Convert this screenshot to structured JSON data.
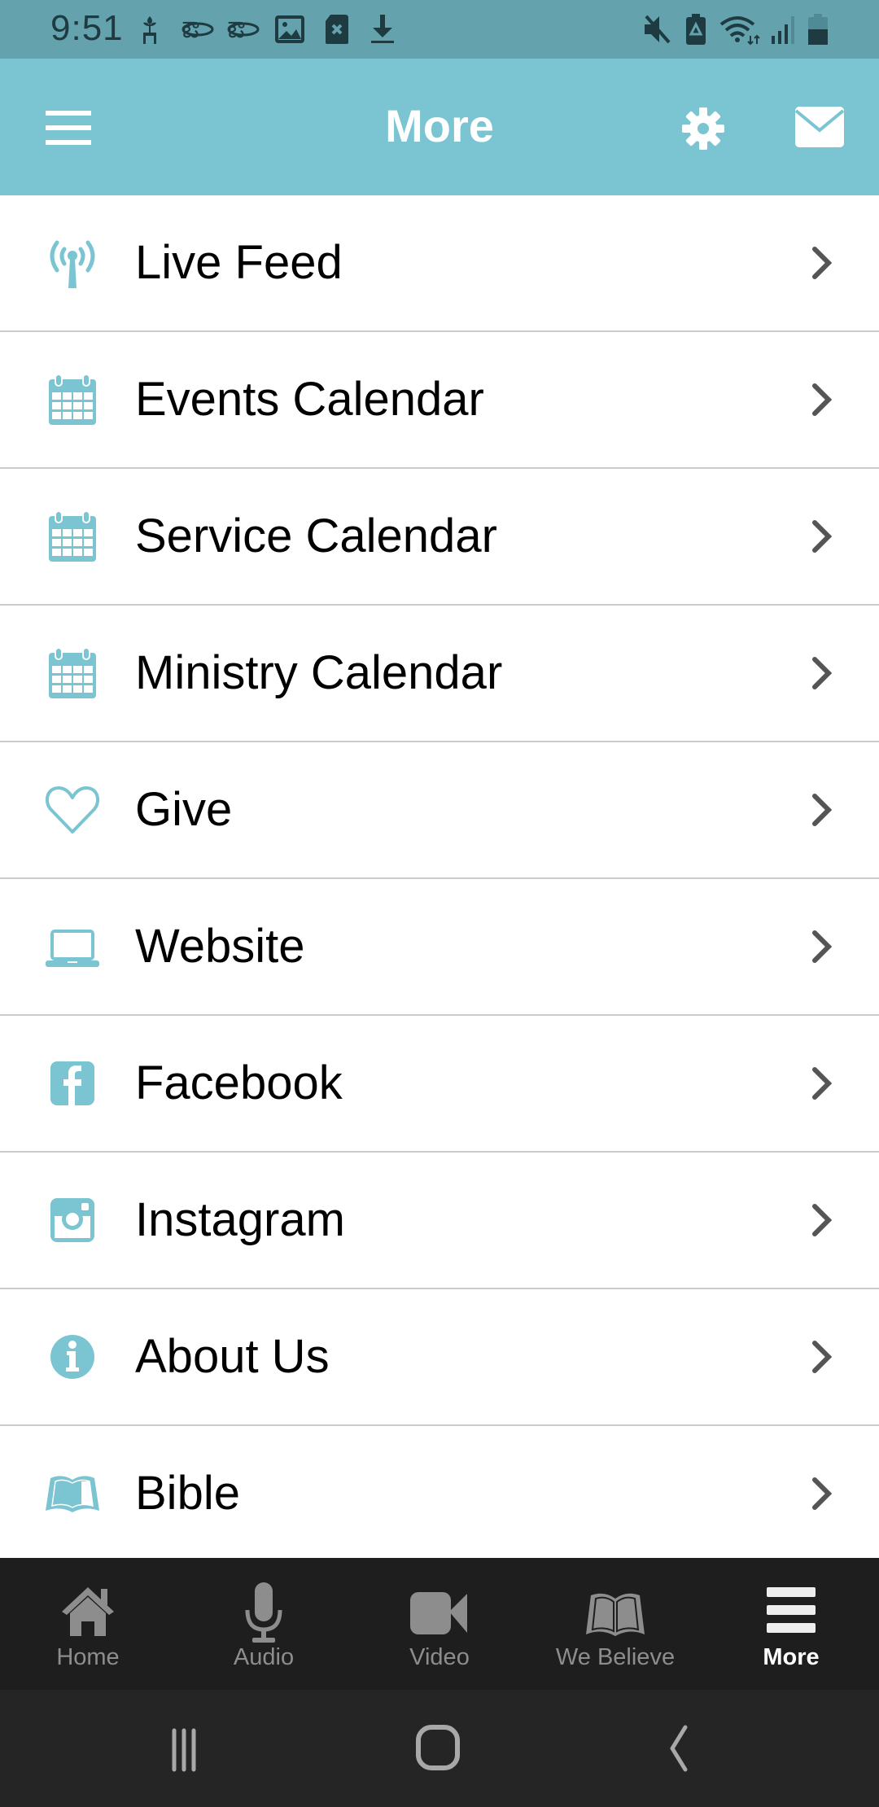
{
  "status_bar": {
    "time": "9:51",
    "left_icons": [
      "plant-notification-icon",
      "bank-notification-icon",
      "bank-notification-icon",
      "image-notification-icon",
      "sd-card-error-icon",
      "download-icon"
    ],
    "right_icons": [
      "mute-icon",
      "battery-saver-icon",
      "wifi-icon",
      "signal-icon",
      "battery-icon"
    ]
  },
  "app_bar": {
    "title": "More",
    "menu_icon": "hamburger-menu-icon",
    "settings_icon": "gear-icon",
    "messages_icon": "mail-icon"
  },
  "colors": {
    "accent": "#7bc4d1",
    "status_bar": "#64a2ae",
    "tab_bar": "#1e1e1e",
    "tab_inactive": "#8d8d8d",
    "tab_active": "#ffffff"
  },
  "menu": {
    "items": [
      {
        "label": "Live Feed",
        "icon": "broadcast-antenna-icon"
      },
      {
        "label": "Events Calendar",
        "icon": "calendar-icon"
      },
      {
        "label": "Service Calendar",
        "icon": "calendar-icon"
      },
      {
        "label": "Ministry Calendar",
        "icon": "calendar-icon"
      },
      {
        "label": "Give",
        "icon": "heart-icon"
      },
      {
        "label": "Website",
        "icon": "laptop-icon"
      },
      {
        "label": "Facebook",
        "icon": "facebook-icon"
      },
      {
        "label": "Instagram",
        "icon": "instagram-icon"
      },
      {
        "label": "About Us",
        "icon": "info-icon"
      },
      {
        "label": "Bible",
        "icon": "open-book-icon"
      }
    ]
  },
  "tab_bar": {
    "tabs": [
      {
        "label": "Home",
        "icon": "home-icon",
        "active": false
      },
      {
        "label": "Audio",
        "icon": "microphone-icon",
        "active": false
      },
      {
        "label": "Video",
        "icon": "video-camera-icon",
        "active": false
      },
      {
        "label": "We Believe",
        "icon": "book-icon",
        "active": false
      },
      {
        "label": "More",
        "icon": "menu-icon",
        "active": true
      }
    ]
  },
  "system_nav": {
    "buttons": [
      "recent-apps",
      "home",
      "back"
    ]
  }
}
